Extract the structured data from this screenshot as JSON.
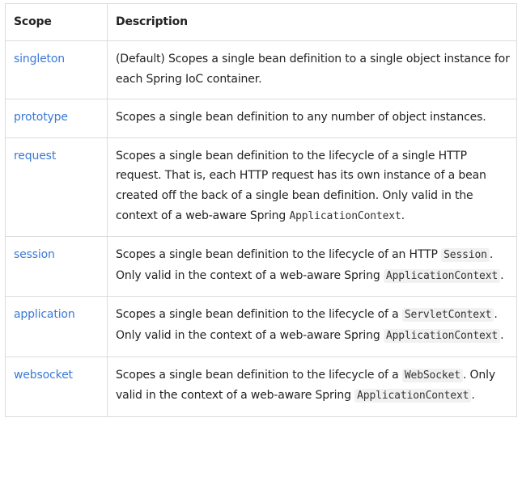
{
  "table": {
    "headers": {
      "scope": "Scope",
      "description": "Description"
    },
    "rows": [
      {
        "scope": "singleton",
        "description": [
          "(Default) Scopes a single bean definition to a single object instance for each Spring IoC container."
        ]
      },
      {
        "scope": "prototype",
        "description": [
          "Scopes a single bean definition to any number of object instances."
        ]
      },
      {
        "scope": "request",
        "description": [
          "Scopes a single bean definition to the lifecycle of a single HTTP request. That is, each HTTP request has its own instance of a bean created off the back of a single bean definition. Only valid in the context of a web-aware Spring ",
          "ApplicationContext",
          "."
        ]
      },
      {
        "scope": "session",
        "description": [
          "Scopes a single bean definition to the lifecycle of an HTTP ",
          "Session",
          ". Only valid in the context of a web-aware Spring ",
          "ApplicationContext",
          "."
        ]
      },
      {
        "scope": "application",
        "description": [
          "Scopes a single bean definition to the lifecycle of a ",
          "ServletContext",
          ". Only valid in the context of a web-aware Spring ",
          "ApplicationContext",
          "."
        ]
      },
      {
        "scope": "websocket",
        "description": [
          "Scopes a single bean definition to the lifecycle of a ",
          "WebSocket",
          ". Only valid in the context of a web-aware Spring ",
          "ApplicationContext",
          "."
        ]
      }
    ]
  }
}
